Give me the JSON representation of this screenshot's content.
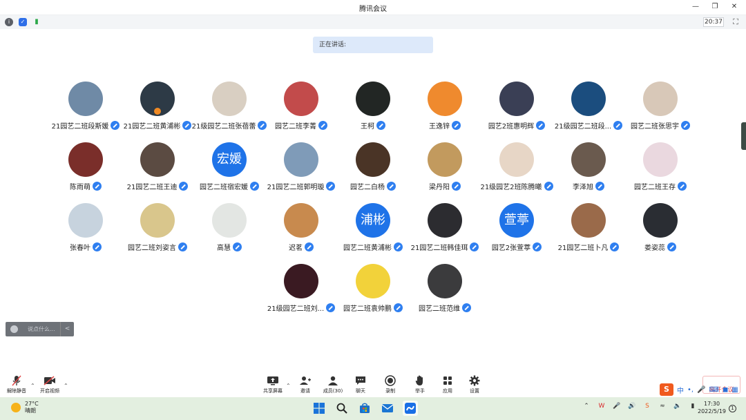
{
  "app": {
    "title": "腾讯会议"
  },
  "statusbar": {
    "time": "20:37"
  },
  "banner": {
    "speaking_label": "正在讲话:"
  },
  "participants": [
    {
      "name": "21园艺二班段斯媛",
      "avatar_color": "#6f8aa6",
      "avatar_text": ""
    },
    {
      "name": "21园艺二班黄浦彬",
      "avatar_color": "#2d3a46",
      "avatar_text": ""
    },
    {
      "name": "21级园艺二班张蓓蕾",
      "avatar_color": "#d9cfc2",
      "avatar_text": ""
    },
    {
      "name": "园艺二班李菁",
      "avatar_color": "#c24b4b",
      "avatar_text": ""
    },
    {
      "name": "王柯",
      "avatar_color": "#222624",
      "avatar_text": ""
    },
    {
      "name": "王逸锌",
      "avatar_color": "#ef8a2e",
      "avatar_text": ""
    },
    {
      "name": "园艺2班惠明辉",
      "avatar_color": "#3a3f55",
      "avatar_text": ""
    },
    {
      "name": "21级园艺二班段...",
      "avatar_color": "#1b4d7e",
      "avatar_text": ""
    },
    {
      "name": "园艺二班张思宇",
      "avatar_color": "#d8c8b8",
      "avatar_text": ""
    },
    {
      "name": "陈雨萌",
      "avatar_color": "#7a2e2a",
      "avatar_text": ""
    },
    {
      "name": "21园艺二班王迪",
      "avatar_color": "#5b4b42",
      "avatar_text": ""
    },
    {
      "name": "园艺二班宿宏媛",
      "avatar_color": "#1f73e8",
      "avatar_text": "宏媛"
    },
    {
      "name": "21园艺二班郭明璇",
      "avatar_color": "#7f9bb8",
      "avatar_text": ""
    },
    {
      "name": "园艺二白杨",
      "avatar_color": "#4a3426",
      "avatar_text": ""
    },
    {
      "name": "梁丹阳",
      "avatar_color": "#c29a5e",
      "avatar_text": ""
    },
    {
      "name": "21级园艺2班陈腾曦",
      "avatar_color": "#e7d6c6",
      "avatar_text": ""
    },
    {
      "name": "李泽旭",
      "avatar_color": "#6a5a4e",
      "avatar_text": ""
    },
    {
      "name": "园艺二班王存",
      "avatar_color": "#ead8df",
      "avatar_text": ""
    },
    {
      "name": "张春叶",
      "avatar_color": "#c7d3de",
      "avatar_text": ""
    },
    {
      "name": "园艺二班刘姿言",
      "avatar_color": "#d9c68c",
      "avatar_text": ""
    },
    {
      "name": "高慧",
      "avatar_color": "#e3e6e3",
      "avatar_text": ""
    },
    {
      "name": "迟茗",
      "avatar_color": "#c88a4e",
      "avatar_text": ""
    },
    {
      "name": "园艺二班黄浦彬",
      "avatar_color": "#1f73e8",
      "avatar_text": "浦彬"
    },
    {
      "name": "21园艺二班韩佳珥",
      "avatar_color": "#2c2c30",
      "avatar_text": ""
    },
    {
      "name": "园艺2张萱葶",
      "avatar_color": "#1f73e8",
      "avatar_text": "萱葶"
    },
    {
      "name": "21园艺二班卜凡",
      "avatar_color": "#9a6a4a",
      "avatar_text": ""
    },
    {
      "name": "娄姿蕊",
      "avatar_color": "#2a2d33",
      "avatar_text": ""
    },
    {
      "name": "21级园艺二班刘...",
      "avatar_color": "#3a1a22",
      "avatar_text": ""
    },
    {
      "name": "园艺二班袁帅鹏",
      "avatar_color": "#f2d23a",
      "avatar_text": ""
    },
    {
      "name": "园艺二班范维",
      "avatar_color": "#3b3b3d",
      "avatar_text": ""
    }
  ],
  "chat": {
    "placeholder": "说点什么..."
  },
  "toolbar": {
    "unmute": "解除静音",
    "start_video": "开启视频",
    "share": "共享屏幕",
    "invite": "邀请",
    "members": "成员(30)",
    "chat": "聊天",
    "record": "录制",
    "raise_hand": "举手",
    "apps": "应用",
    "settings": "设置",
    "end": "离开会议"
  },
  "taskbar": {
    "temp": "27°C",
    "weather": "晴朗",
    "time": "17:30",
    "date": "2022/5/19",
    "notifications": "1"
  },
  "ime": {
    "mode": "中"
  },
  "colors": {
    "accent": "#1f73e8",
    "taskbar": "#e3efe0"
  }
}
